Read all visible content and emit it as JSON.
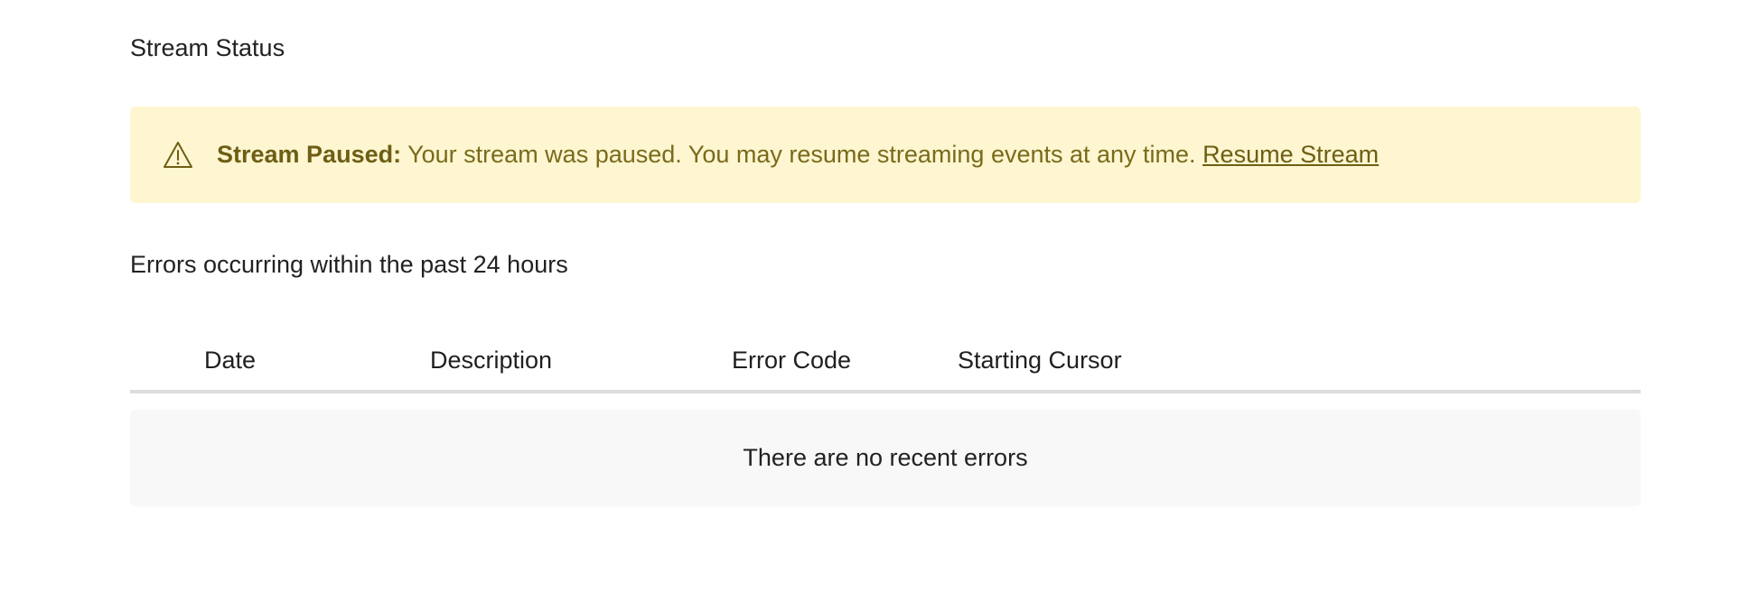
{
  "stream_status": {
    "title": "Stream Status"
  },
  "alert": {
    "icon": "warning-triangle-icon",
    "heading": "Stream Paused:",
    "message": " Your stream was paused. You may resume streaming events at any time. ",
    "link_label": "Resume Stream",
    "colors": {
      "background": "#fdf6d0",
      "text": "#7a6a1c"
    }
  },
  "errors": {
    "title": "Errors occurring within the past 24 hours",
    "columns": [
      "Date",
      "Description",
      "Error Code",
      "Starting Cursor"
    ],
    "rows": [],
    "empty_message": "There are no recent errors"
  }
}
